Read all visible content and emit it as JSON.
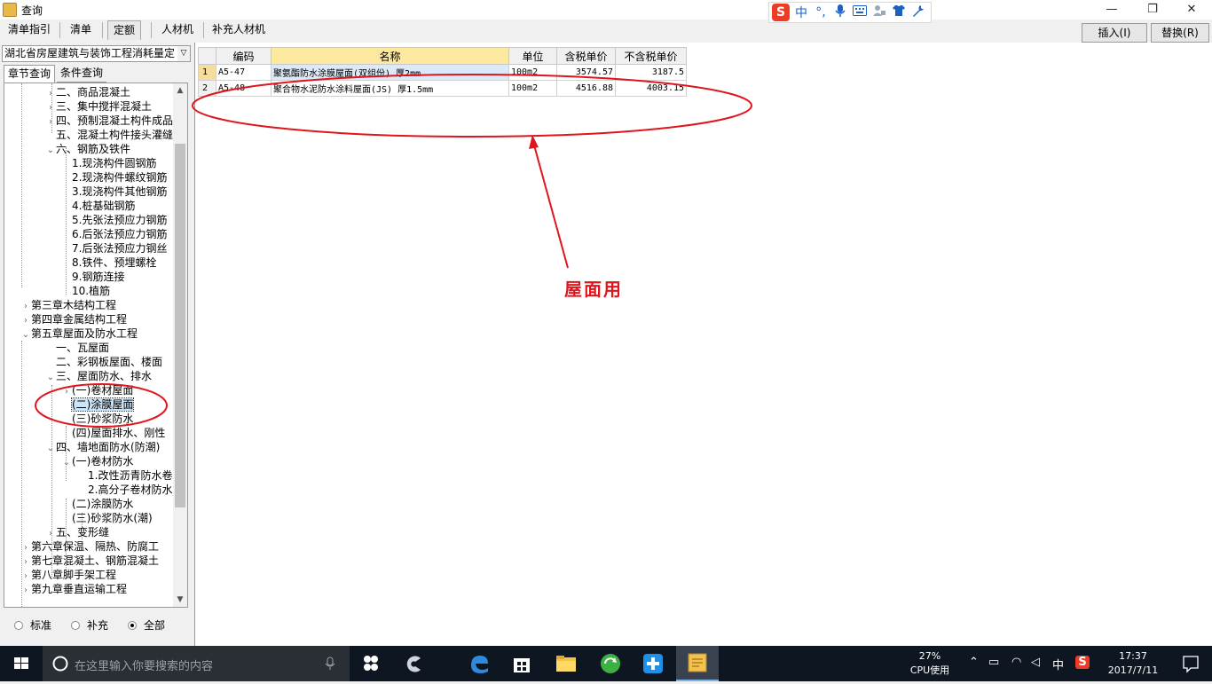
{
  "window": {
    "title": "查询",
    "minimize": "—",
    "maximize": "❐",
    "close": "✕"
  },
  "ime": {
    "logo": "S",
    "mode": "中",
    "punct": "°,",
    "icons": [
      "microphone-icon",
      "keyboard-icon",
      "user-icon",
      "skin-icon",
      "wrench-icon"
    ]
  },
  "toolbar": {
    "tabs": [
      "清单指引",
      "清单",
      "定额",
      "人材机",
      "补充人材机"
    ],
    "active_tab": "定额",
    "insert_label": "插入(I)",
    "replace_label": "替换(R)"
  },
  "left": {
    "library": "湖北省房屋建筑与装饰工程消耗量定",
    "tab_chapter": "章节查询",
    "tab_condition": "条件查询",
    "tree": [
      {
        "label": "二、商品混凝土",
        "exp": ">"
      },
      {
        "label": "三、集中搅拌混凝土",
        "exp": ">"
      },
      {
        "label": "四、预制混凝土构件成品",
        "exp": ">"
      },
      {
        "label": "五、混凝土构件接头灌缝",
        "exp": ""
      },
      {
        "label": "六、钢筋及铁件",
        "exp": "v"
      },
      {
        "label": "1.现浇构件圆钢筋",
        "exp": ""
      },
      {
        "label": "2.现浇构件螺纹钢筋",
        "exp": ""
      },
      {
        "label": "3.现浇构件其他钢筋",
        "exp": ""
      },
      {
        "label": "4.桩基础钢筋",
        "exp": ""
      },
      {
        "label": "5.先张法预应力钢筋",
        "exp": ""
      },
      {
        "label": "6.后张法预应力钢筋",
        "exp": ""
      },
      {
        "label": "7.后张法预应力钢丝",
        "exp": ""
      },
      {
        "label": "8.铁件、预埋螺栓",
        "exp": ""
      },
      {
        "label": "9.钢筋连接",
        "exp": ""
      },
      {
        "label": "10.植筋",
        "exp": ""
      },
      {
        "label": "第三章木结构工程",
        "exp": ">"
      },
      {
        "label": "第四章金属结构工程",
        "exp": ">"
      },
      {
        "label": "第五章屋面及防水工程",
        "exp": "v"
      },
      {
        "label": "一、瓦屋面",
        "exp": ""
      },
      {
        "label": "二、彩钢板屋面、楼面",
        "exp": ""
      },
      {
        "label": "三、屋面防水、排水",
        "exp": "v"
      },
      {
        "label": "(一)卷材屋面",
        "exp": ">"
      },
      {
        "label": "(二)涂膜屋面",
        "exp": ""
      },
      {
        "label": "(三)砂浆防水",
        "exp": ""
      },
      {
        "label": "(四)屋面排水、刚性",
        "exp": ""
      },
      {
        "label": "四、墙地面防水(防潮)",
        "exp": "v"
      },
      {
        "label": "(一)卷材防水",
        "exp": "v"
      },
      {
        "label": "1.改性沥青防水卷",
        "exp": ""
      },
      {
        "label": "2.高分子卷材防水",
        "exp": ""
      },
      {
        "label": "(二)涂膜防水",
        "exp": ""
      },
      {
        "label": "(三)砂浆防水(潮)",
        "exp": ""
      },
      {
        "label": "五、变形缝",
        "exp": ">"
      },
      {
        "label": "第六章保温、隔热、防腐工",
        "exp": ">"
      },
      {
        "label": "第七章混凝土、钢筋混凝土",
        "exp": ">"
      },
      {
        "label": "第八章脚手架工程",
        "exp": ">"
      },
      {
        "label": "第九章垂直运输工程",
        "exp": ">"
      }
    ],
    "selected": "(二)涂膜屋面",
    "radio_standard": "标准",
    "radio_supplement": "补充",
    "radio_all": "全部",
    "radio_selected": "全部"
  },
  "grid": {
    "headers": [
      "编码",
      "名称",
      "单位",
      "含税单价",
      "不含税单价"
    ],
    "rows": [
      {
        "n": "1",
        "code": "A5-47",
        "name": "聚氨酯防水涂膜屋面(双组份) 厚2mm",
        "unit": "100m2",
        "tax_price": "3574.57",
        "notax_price": "3187.5"
      },
      {
        "n": "2",
        "code": "A5-48",
        "name": "聚合物水泥防水涂料屋面(JS) 厚1.5mm",
        "unit": "100m2",
        "tax_price": "4516.88",
        "notax_price": "4003.15"
      }
    ]
  },
  "annotation": {
    "text": "屋面用",
    "color": "#e0141c"
  },
  "taskbar": {
    "search_placeholder": "在这里输入你要搜索的内容",
    "cpu_percent": "27%",
    "cpu_label": "CPU使用",
    "ime_mode": "中",
    "time": "17:37",
    "date": "2017/7/11"
  }
}
